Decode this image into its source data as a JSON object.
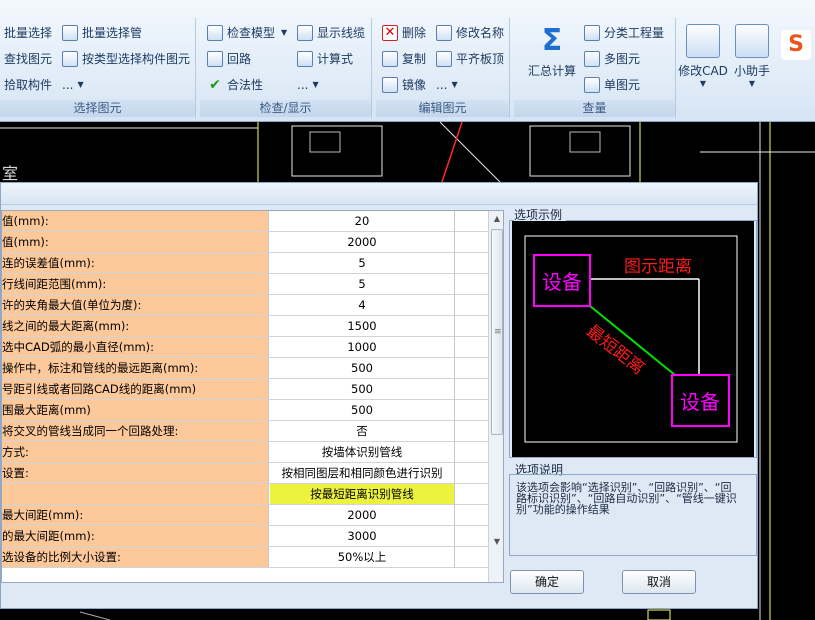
{
  "ribbon": {
    "select_group": {
      "batch_select": "批量选择",
      "batch_select_pipe": "批量选择管",
      "find_element": "查找图元",
      "select_by_type": "按类型选择构件图元",
      "pick_component": "拾取构件",
      "more": "...",
      "label": "选择图元"
    },
    "check_group": {
      "check_model": "检查模型",
      "show_lines": "显示线缆",
      "circuit": "回路",
      "formula": "计算式",
      "legality": "合法性",
      "more1": "...",
      "more2": "...",
      "label": "检查/显示"
    },
    "edit_group": {
      "delete": "删除",
      "rename": "修改名称",
      "copy": "复制",
      "flat_board": "平齐板顶",
      "mirror": "镜像",
      "more": "...",
      "label": "编辑图元"
    },
    "quantity_group": {
      "summary_calc": "汇总计算",
      "category_quantity": "分类工程量",
      "multi_element": "多图元",
      "single_element": "单图元",
      "label": "查量"
    },
    "modify_cad": "修改CAD",
    "assistant": "小助手"
  },
  "cad_room_text": "室",
  "settings_rows": [
    {
      "label": "值(mm):",
      "value": "20"
    },
    {
      "label": "值(mm):",
      "value": "2000"
    },
    {
      "label": "连的误差值(mm):",
      "value": "5"
    },
    {
      "label": "行线间距范围(mm):",
      "value": "5"
    },
    {
      "label": "许的夹角最大值(单位为度):",
      "value": "4"
    },
    {
      "label": "线之间的最大距离(mm):",
      "value": "1500"
    },
    {
      "label": "选中CAD弧的最小直径(mm):",
      "value": "1000"
    },
    {
      "label": "操作中，标注和管线的最远距离(mm):",
      "value": "500"
    },
    {
      "label": "号距引线或者回路CAD线的距离(mm)",
      "value": "500"
    },
    {
      "label": "围最大距离(mm)",
      "value": "500"
    },
    {
      "label": "将交叉的管线当成同一个回路处理:",
      "value": "否"
    },
    {
      "label": "方式:",
      "value": "按墙体识别管线"
    },
    {
      "label": "设置:",
      "value": "按相同图层和相同颜色进行识别"
    },
    {
      "label": "",
      "value": "按最短距离识别管线",
      "highlight": true
    },
    {
      "label": "最大间距(mm):",
      "value": "2000"
    },
    {
      "label": "的最大间距(mm):",
      "value": "3000"
    },
    {
      "label": "选设备的比例大小设置:",
      "value": "50%以上"
    }
  ],
  "example": {
    "section_label": "选项示例",
    "device_label": "设备",
    "shown_distance": "图示距离",
    "shortest_distance": "最短距离"
  },
  "description": {
    "section_label": "选项说明",
    "text": "该选项会影响“选择识别”、“回路识别”、“回路标识识别”、“回路自动识别”、“管线一键识别”功能的操作结果"
  },
  "buttons": {
    "ok": "确定",
    "cancel": "取消"
  },
  "colors": {
    "label_cell_bg": "#fdc99b",
    "highlight_cell_bg": "#ecf23e",
    "device_magenta": "#ff00ff",
    "distance_red": "#ff1a1a",
    "shortest_line_green": "#00e000"
  }
}
